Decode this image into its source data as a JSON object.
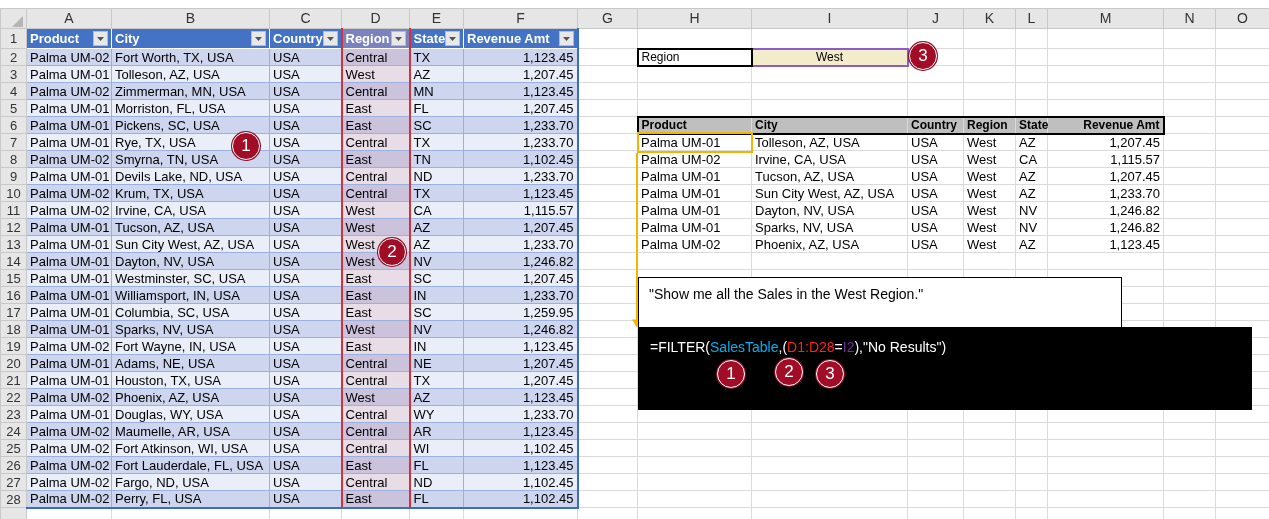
{
  "column_letters": [
    "A",
    "B",
    "C",
    "D",
    "E",
    "F",
    "G",
    "H",
    "I",
    "J",
    "K",
    "L",
    "M",
    "N",
    "O"
  ],
  "row_numbers": [
    "1",
    "2",
    "3",
    "4",
    "5",
    "6",
    "7",
    "8",
    "9",
    "10",
    "11",
    "12",
    "13",
    "14",
    "15",
    "16",
    "17",
    "18",
    "19",
    "20",
    "21",
    "22",
    "23",
    "24",
    "25",
    "26",
    "27",
    "28"
  ],
  "sales_table": {
    "highlighted": true,
    "columns": [
      {
        "label": "Product",
        "highlighted": false
      },
      {
        "label": "City",
        "highlighted": false
      },
      {
        "label": "Country",
        "highlighted": false
      },
      {
        "label": "Region",
        "highlighted": true
      },
      {
        "label": "State",
        "highlighted": false
      },
      {
        "label": "Revenue Amt",
        "highlighted": false
      }
    ],
    "rows": [
      [
        "Palma UM-02",
        "Fort Worth, TX, USA",
        "USA",
        "Central",
        "TX",
        "1,123.45"
      ],
      [
        "Palma UM-01",
        "Tolleson, AZ, USA",
        "USA",
        "West",
        "AZ",
        "1,207.45"
      ],
      [
        "Palma UM-02",
        "Zimmerman, MN, USA",
        "USA",
        "Central",
        "MN",
        "1,123.45"
      ],
      [
        "Palma UM-01",
        "Morriston, FL, USA",
        "USA",
        "East",
        "FL",
        "1,207.45"
      ],
      [
        "Palma UM-01",
        "Pickens, SC, USA",
        "USA",
        "East",
        "SC",
        "1,233.70"
      ],
      [
        "Palma UM-01",
        "Rye, TX, USA",
        "USA",
        "Central",
        "TX",
        "1,233.70"
      ],
      [
        "Palma UM-02",
        "Smyrna, TN, USA",
        "USA",
        "East",
        "TN",
        "1,102.45"
      ],
      [
        "Palma UM-01",
        "Devils Lake, ND, USA",
        "USA",
        "Central",
        "ND",
        "1,233.70"
      ],
      [
        "Palma UM-02",
        "Krum, TX, USA",
        "USA",
        "Central",
        "TX",
        "1,123.45"
      ],
      [
        "Palma UM-02",
        "Irvine, CA, USA",
        "USA",
        "West",
        "CA",
        "1,115.57"
      ],
      [
        "Palma UM-01",
        "Tucson, AZ, USA",
        "USA",
        "West",
        "AZ",
        "1,207.45"
      ],
      [
        "Palma UM-01",
        "Sun City West, AZ, USA",
        "USA",
        "West",
        "AZ",
        "1,233.70"
      ],
      [
        "Palma UM-01",
        "Dayton, NV, USA",
        "USA",
        "West",
        "NV",
        "1,246.82"
      ],
      [
        "Palma UM-01",
        "Westminster, SC, USA",
        "USA",
        "East",
        "SC",
        "1,207.45"
      ],
      [
        "Palma UM-01",
        "Williamsport, IN, USA",
        "USA",
        "East",
        "IN",
        "1,233.70"
      ],
      [
        "Palma UM-01",
        "Columbia, SC, USA",
        "USA",
        "East",
        "SC",
        "1,259.95"
      ],
      [
        "Palma UM-01",
        "Sparks, NV, USA",
        "USA",
        "West",
        "NV",
        "1,246.82"
      ],
      [
        "Palma UM-02",
        "Fort Wayne, IN, USA",
        "USA",
        "East",
        "IN",
        "1,123.45"
      ],
      [
        "Palma UM-01",
        "Adams, NE, USA",
        "USA",
        "Central",
        "NE",
        "1,207.45"
      ],
      [
        "Palma UM-01",
        "Houston, TX, USA",
        "USA",
        "Central",
        "TX",
        "1,207.45"
      ],
      [
        "Palma UM-02",
        "Phoenix, AZ, USA",
        "USA",
        "West",
        "AZ",
        "1,123.45"
      ],
      [
        "Palma UM-01",
        "Douglas, WY, USA",
        "USA",
        "Central",
        "WY",
        "1,233.70"
      ],
      [
        "Palma UM-02",
        "Maumelle, AR, USA",
        "USA",
        "Central",
        "AR",
        "1,123.45"
      ],
      [
        "Palma UM-02",
        "Fort Atkinson, WI, USA",
        "USA",
        "Central",
        "WI",
        "1,102.45"
      ],
      [
        "Palma UM-02",
        "Fort Lauderdale, FL, USA",
        "USA",
        "East",
        "FL",
        "1,123.45"
      ],
      [
        "Palma UM-02",
        "Fargo, ND, USA",
        "USA",
        "Central",
        "ND",
        "1,102.45"
      ],
      [
        "Palma UM-02",
        "Perry, FL, USA",
        "USA",
        "East",
        "FL",
        "1,102.45"
      ]
    ]
  },
  "criteria": {
    "label": "Region",
    "value": "West",
    "highlighted": true
  },
  "filter_results": {
    "columns": [
      "Product",
      "City",
      "Country",
      "Region",
      "State",
      "Revenue Amt"
    ],
    "rows": [
      [
        "Palma UM-01",
        "Tolleson, AZ, USA",
        "USA",
        "West",
        "AZ",
        "1,207.45"
      ],
      [
        "Palma UM-02",
        "Irvine, CA, USA",
        "USA",
        "West",
        "CA",
        "1,115.57"
      ],
      [
        "Palma UM-01",
        "Tucson, AZ, USA",
        "USA",
        "West",
        "AZ",
        "1,207.45"
      ],
      [
        "Palma UM-01",
        "Sun City West, AZ, USA",
        "USA",
        "West",
        "AZ",
        "1,233.70"
      ],
      [
        "Palma UM-01",
        "Dayton, NV, USA",
        "USA",
        "West",
        "NV",
        "1,246.82"
      ],
      [
        "Palma UM-01",
        "Sparks, NV, USA",
        "USA",
        "West",
        "NV",
        "1,246.82"
      ],
      [
        "Palma UM-02",
        "Phoenix, AZ, USA",
        "USA",
        "West",
        "AZ",
        "1,123.45"
      ]
    ]
  },
  "callouts": [
    {
      "number": "1"
    },
    {
      "number": "2"
    },
    {
      "number": "3"
    }
  ],
  "note": "\"Show me all the Sales in the West Region.\"",
  "formula": {
    "parts": [
      {
        "text": "=FILTER(",
        "color": "#ffffff"
      },
      {
        "text": "SalesTable",
        "color": "#00b0f0"
      },
      {
        "text": ",(",
        "color": "#ffffff"
      },
      {
        "text": "D1:D28",
        "color": "#ff2020"
      },
      {
        "text": "=",
        "color": "#ffffff"
      },
      {
        "text": "I2",
        "color": "#7030a0"
      },
      {
        "text": "),\"No Results\")",
        "color": "#ffffff"
      }
    ],
    "markers": [
      {
        "number": "1"
      },
      {
        "number": "2"
      },
      {
        "number": "3"
      }
    ]
  }
}
